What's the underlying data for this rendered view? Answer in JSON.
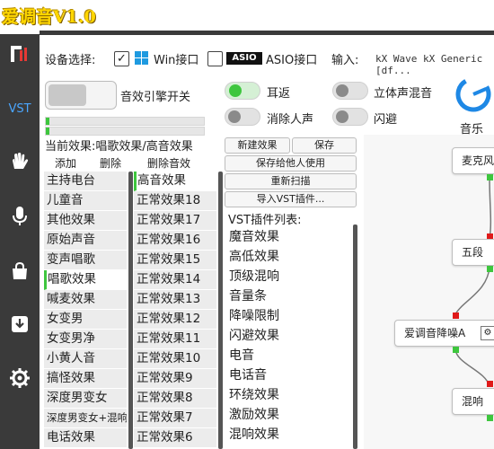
{
  "app": {
    "title": "爱调音V1.0"
  },
  "sidebar": {
    "vst_label": "VST",
    "items": [
      {
        "icon": "tuner-logo-icon"
      },
      {
        "icon": "vst-icon"
      },
      {
        "icon": "hand-wave-icon"
      },
      {
        "icon": "microphone-icon"
      },
      {
        "icon": "shopping-bag-icon"
      },
      {
        "icon": "download-icon"
      },
      {
        "icon": "gear-icon"
      }
    ]
  },
  "device": {
    "label": "设备选择:",
    "win": {
      "label": "Win接口",
      "checked": true,
      "check_glyph": "✓"
    },
    "asio": {
      "label": "ASIO接口",
      "checked": false,
      "logo_text": "ASIO"
    },
    "input_label": "输入:",
    "input_value": "kX Wave kX Generic [df..."
  },
  "engine_switch": {
    "label": "音效引擎开关"
  },
  "toggles": [
    {
      "id": "ear-return",
      "label": "耳返",
      "on": true
    },
    {
      "id": "stereo-mix",
      "label": "立体声混音",
      "on": false
    },
    {
      "id": "vocal-remove",
      "label": "消除人声",
      "on": false
    },
    {
      "id": "ducking",
      "label": "闪避",
      "on": false
    }
  ],
  "music": {
    "label": "音乐"
  },
  "meters": [
    {
      "level": 0.02
    },
    {
      "level": 0.02
    }
  ],
  "current_effect": {
    "label": "当前效果:唱歌效果/高音效果"
  },
  "actions": {
    "add": "添加",
    "delete": "删除",
    "delete_effect": "删除音效"
  },
  "buttons": {
    "new_effect": "新建效果",
    "save": "保存",
    "save_for_others": "保存给他人使用",
    "rescan": "重新扫描",
    "import_vst": "导入VST插件..."
  },
  "categories": [
    "主持电台",
    "儿童音",
    "其他效果",
    "原始声音",
    "变声唱歌",
    "唱歌效果",
    "喊麦效果",
    "女变男",
    "女变男净",
    "小黄人音",
    "搞怪效果",
    "深度男变女",
    "深度男变女+混响",
    "电话效果"
  ],
  "selected_category": "唱歌效果",
  "effects": [
    "高音效果",
    "正常效果18",
    "正常效果17",
    "正常效果16",
    "正常效果15",
    "正常效果14",
    "正常效果13",
    "正常效果12",
    "正常效果11",
    "正常效果10",
    "正常效果9",
    "正常效果8",
    "正常效果7",
    "正常效果6"
  ],
  "selected_effect": "高音效果",
  "vst": {
    "title": "VST插件列表:",
    "plugins": [
      "魔音效果",
      "高低效果",
      "顶级混响",
      "音量条",
      "降噪限制",
      "闪避效果",
      "电音",
      "电话音",
      "环绕效果",
      "激励效果",
      "混响效果"
    ]
  },
  "graph": {
    "nodes": [
      "麦克风",
      "五段",
      "爱调音降噪A",
      "混响"
    ],
    "node_extra_glyph": "⚙"
  },
  "colors": {
    "accent": "#3ec63e",
    "port_red": "#e01a1a",
    "sidebar_bg": "#3a3a3a",
    "title_gold": "#ffd700",
    "vst_blue": "#4aa6ff"
  }
}
